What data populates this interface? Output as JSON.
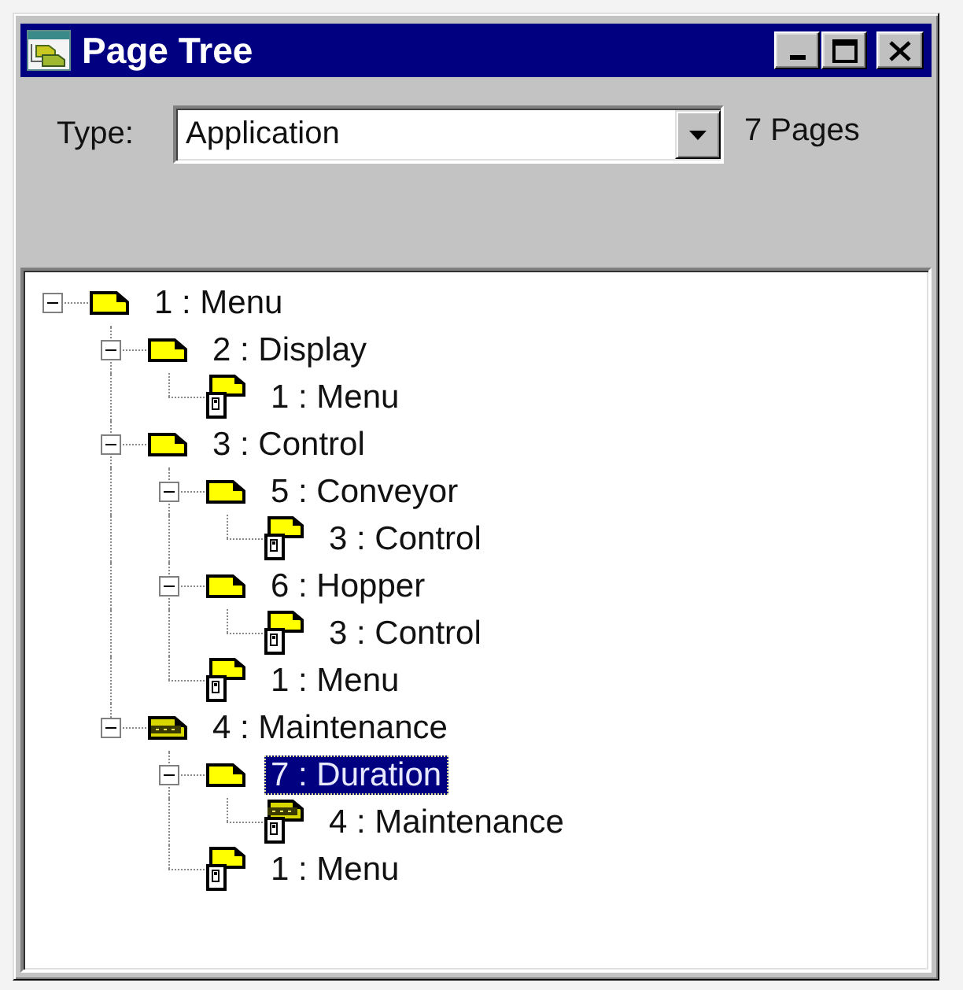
{
  "window": {
    "title": "Page Tree"
  },
  "toolbar": {
    "type_label": "Type:",
    "type_select": {
      "value": "Application"
    },
    "page_count": "7 Pages"
  },
  "tree": [
    {
      "label": "1 : Menu",
      "kind": "page",
      "banded": false,
      "expanded": true,
      "selected": false,
      "children": [
        {
          "label": "2 : Display",
          "kind": "page",
          "banded": false,
          "expanded": true,
          "selected": false,
          "children": [
            {
              "label": "1 : Menu",
              "kind": "link",
              "banded": false,
              "selected": false
            }
          ]
        },
        {
          "label": "3 : Control",
          "kind": "page",
          "banded": false,
          "expanded": true,
          "selected": false,
          "children": [
            {
              "label": "5 : Conveyor",
              "kind": "page",
              "banded": false,
              "expanded": true,
              "selected": false,
              "children": [
                {
                  "label": "3 : Control",
                  "kind": "link",
                  "banded": false,
                  "selected": false
                }
              ]
            },
            {
              "label": "6 : Hopper",
              "kind": "page",
              "banded": false,
              "expanded": true,
              "selected": false,
              "children": [
                {
                  "label": "3 : Control",
                  "kind": "link",
                  "banded": false,
                  "selected": false
                }
              ]
            },
            {
              "label": "1 : Menu",
              "kind": "link",
              "banded": false,
              "selected": false
            }
          ]
        },
        {
          "label": "4 : Maintenance",
          "kind": "page",
          "banded": true,
          "expanded": true,
          "selected": false,
          "children": [
            {
              "label": "7 : Duration",
              "kind": "page",
              "banded": false,
              "expanded": true,
              "selected": true,
              "children": [
                {
                  "label": "4 : Maintenance",
                  "kind": "link",
                  "banded": true,
                  "selected": false
                }
              ]
            },
            {
              "label": "1 : Menu",
              "kind": "link",
              "banded": false,
              "selected": false
            }
          ]
        }
      ]
    }
  ]
}
